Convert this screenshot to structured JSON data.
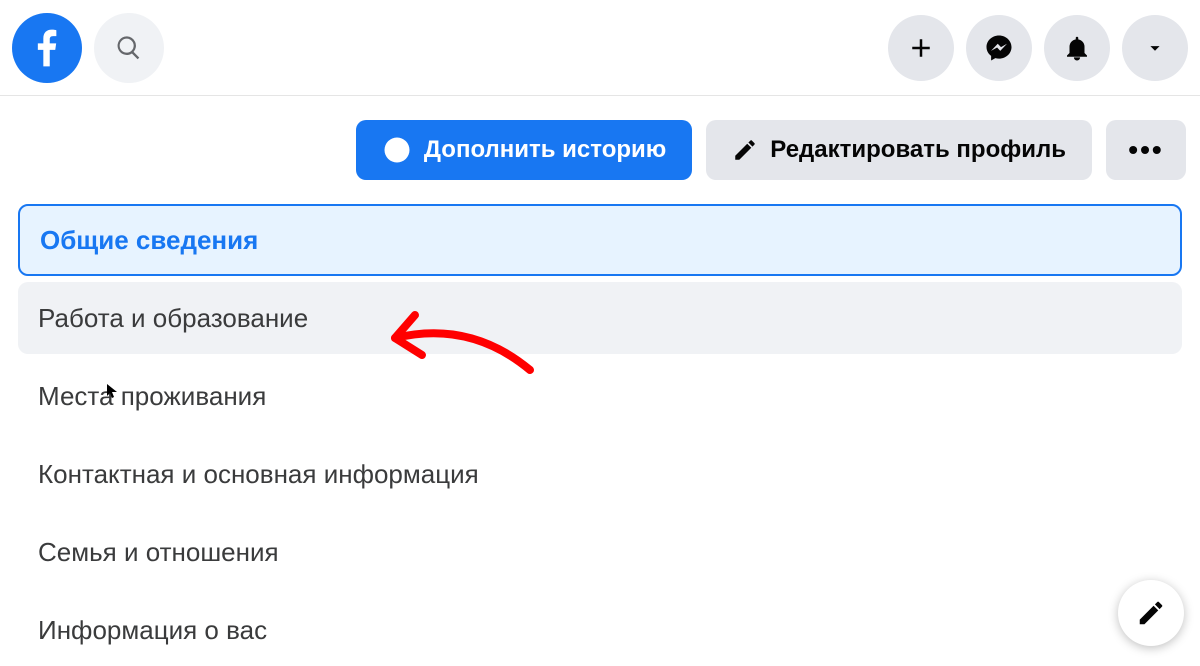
{
  "topbar": {
    "logo_name": "facebook-logo",
    "search_name": "search-icon"
  },
  "top_buttons": {
    "create": "plus-icon",
    "messenger": "messenger-icon",
    "notifications": "bell-icon",
    "account": "caret-down-icon"
  },
  "actions": {
    "add_story": "Дополнить историю",
    "edit_profile": "Редактировать профиль",
    "more": "•••"
  },
  "about_nav": [
    {
      "label": "Общие сведения",
      "state": "active"
    },
    {
      "label": "Работа и образование",
      "state": "hover"
    },
    {
      "label": "Места проживания",
      "state": "default"
    },
    {
      "label": "Контактная и основная информация",
      "state": "default"
    },
    {
      "label": "Семья и отношения",
      "state": "default"
    },
    {
      "label": "Информация о вас",
      "state": "default"
    }
  ]
}
